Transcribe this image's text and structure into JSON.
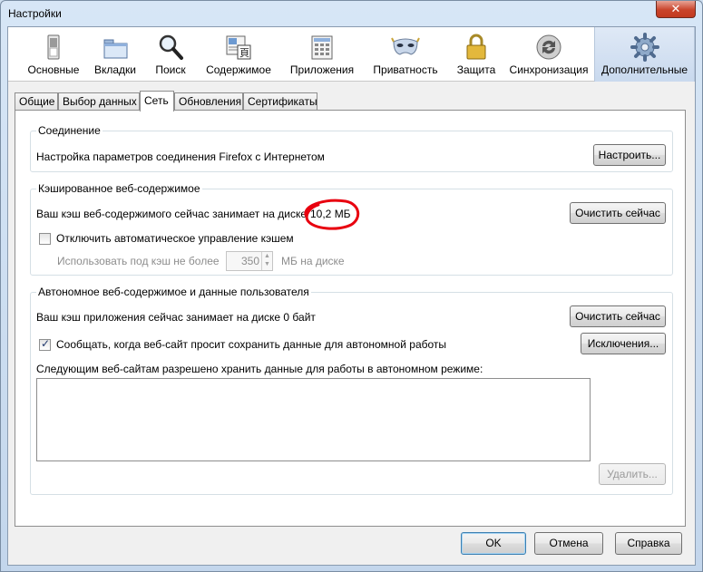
{
  "window": {
    "title": "Настройки",
    "close_label": "✕"
  },
  "toolbar": {
    "items": [
      {
        "label": "Основные"
      },
      {
        "label": "Вкладки"
      },
      {
        "label": "Поиск"
      },
      {
        "label": "Содержимое"
      },
      {
        "label": "Приложения"
      },
      {
        "label": "Приватность"
      },
      {
        "label": "Защита"
      },
      {
        "label": "Синхронизация"
      },
      {
        "label": "Дополнительные"
      }
    ]
  },
  "subtabs": [
    {
      "label": "Общие"
    },
    {
      "label": "Выбор данных"
    },
    {
      "label": "Сеть"
    },
    {
      "label": "Обновления"
    },
    {
      "label": "Сертификаты"
    }
  ],
  "connection": {
    "title": "Соединение",
    "text": "Настройка параметров соединения Firefox с Интернетом",
    "button": "Настроить..."
  },
  "cache": {
    "title": "Кэшированное веб-содержимое",
    "text": "Ваш кэш веб-содержимого сейчас занимает на диске",
    "size": "10,2 МБ",
    "button": "Очистить сейчас",
    "override_label": "Отключить автоматическое управление кэшем",
    "override_checked": false,
    "limit_prefix": "Использовать под кэш не более",
    "limit_value": "350",
    "limit_suffix": "МБ на диске"
  },
  "offline": {
    "title": "Автономное веб-содержимое и данные пользователя",
    "text": "Ваш кэш приложения сейчас занимает на диске 0 байт",
    "clear_button": "Очистить сейчас",
    "notify_label": "Сообщать, когда веб-сайт просит сохранить данные для автономной работы",
    "notify_checked": true,
    "exceptions_button": "Исключения...",
    "list_label": "Следующим веб-сайтам разрешено хранить данные для работы в автономном режиме:",
    "list_items": [],
    "remove_button": "Удалить..."
  },
  "footer": {
    "ok": "OK",
    "cancel": "Отмена",
    "help": "Справка"
  },
  "colors": {
    "annotation": "#e8000f",
    "selected_tab_bg": "#d3e0f1"
  }
}
